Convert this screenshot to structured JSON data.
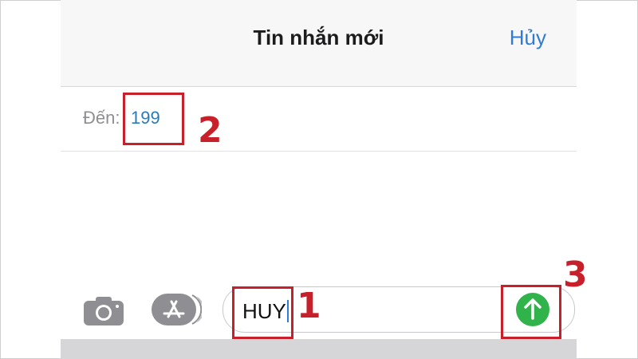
{
  "header": {
    "title": "Tin nhắn mới",
    "cancel_label": "Hủy"
  },
  "recipient": {
    "label": "Đến:",
    "value": "199"
  },
  "composer": {
    "message_text": "HUY",
    "camera_icon": "camera-icon",
    "appstore_icon": "app-store-icon",
    "send_icon": "arrow-up-icon"
  },
  "annotations": {
    "step1": "1",
    "step2": "2",
    "step3": "3"
  },
  "colors": {
    "accent": "#2f7bd6",
    "send_green": "#2fb34a",
    "annotation_red": "#c8202a"
  }
}
